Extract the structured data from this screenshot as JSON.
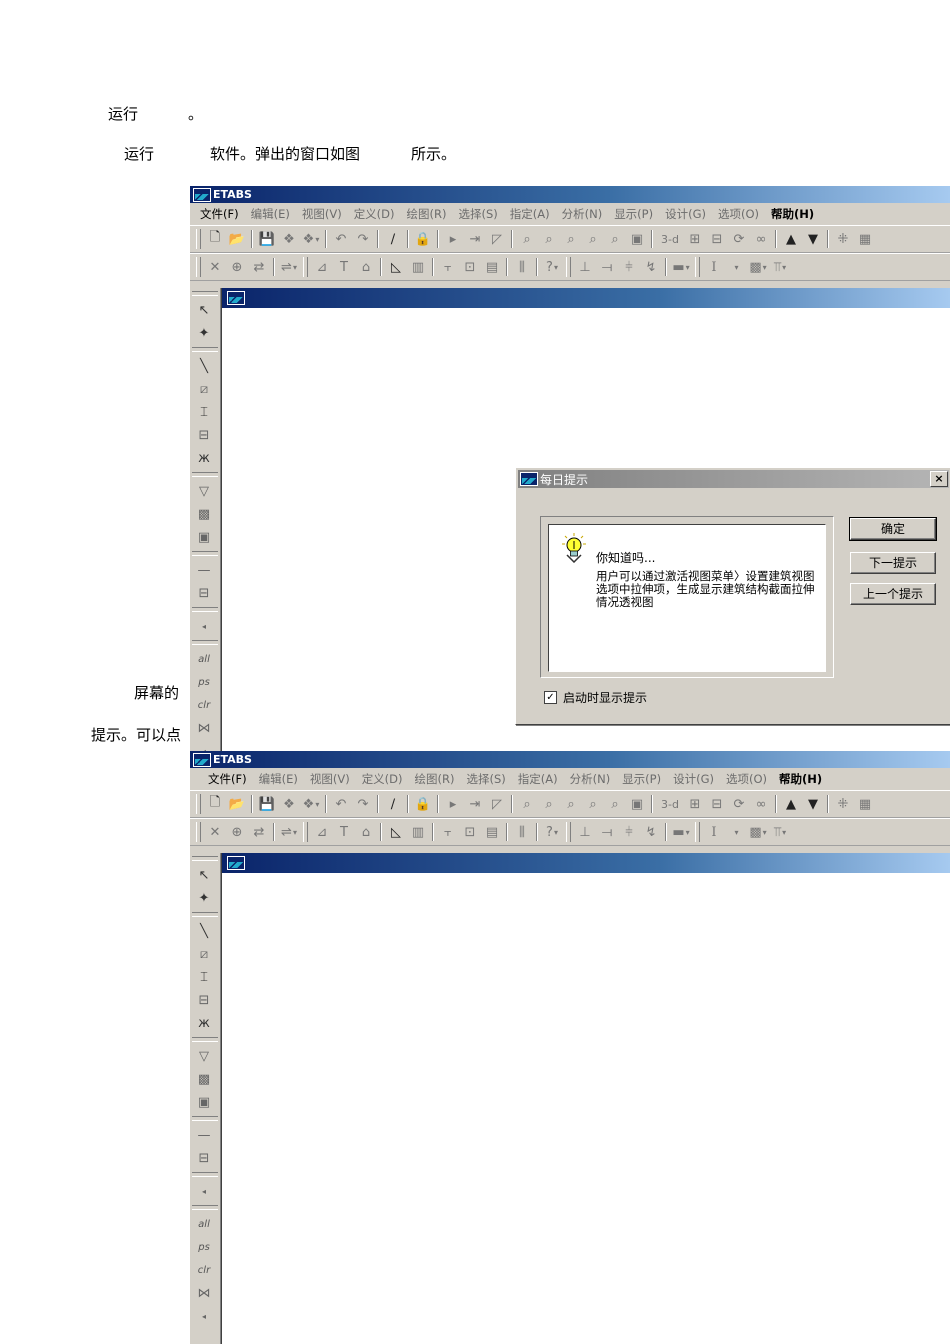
{
  "doc": {
    "line1_a": "运行",
    "line1_b": "。",
    "line2_a": "运行",
    "line2_b": "软件。弹出的窗口如图",
    "line2_c": "所示。",
    "line3": "屏幕的",
    "line4": "提示。可以点"
  },
  "window1": {
    "title": "ETABS",
    "menu": [
      "文件(F)",
      "编辑(E)",
      "视图(V)",
      "定义(D)",
      "绘图(R)",
      "选择(S)",
      "指定(A)",
      "分析(N)",
      "显示(P)",
      "设计(G)",
      "选项(O)",
      "帮助(H)"
    ]
  },
  "window2": {
    "title": "ETABS",
    "menu": [
      "文件(F)",
      "编辑(E)",
      "视图(V)",
      "定义(D)",
      "绘图(R)",
      "选择(S)",
      "指定(A)",
      "分析(N)",
      "显示(P)",
      "设计(G)",
      "选项(O)",
      "帮助(H)"
    ]
  },
  "toolbar": {
    "view_3d": "3-d",
    "font_sample": "I"
  },
  "left_labels": [
    "all",
    "ps",
    "clr"
  ],
  "dialog": {
    "title": "每日提示",
    "close": "×",
    "tip_heading": "你知道吗...",
    "tip_text": "用户可以通过激活视图菜单〉设置建筑视图选项中拉伸项，生成显示建筑结构截面拉伸情况透视图",
    "ok": "确定",
    "next": "下一提示",
    "prev": "上一个提示",
    "show_on_startup": "启动时显示提示"
  }
}
